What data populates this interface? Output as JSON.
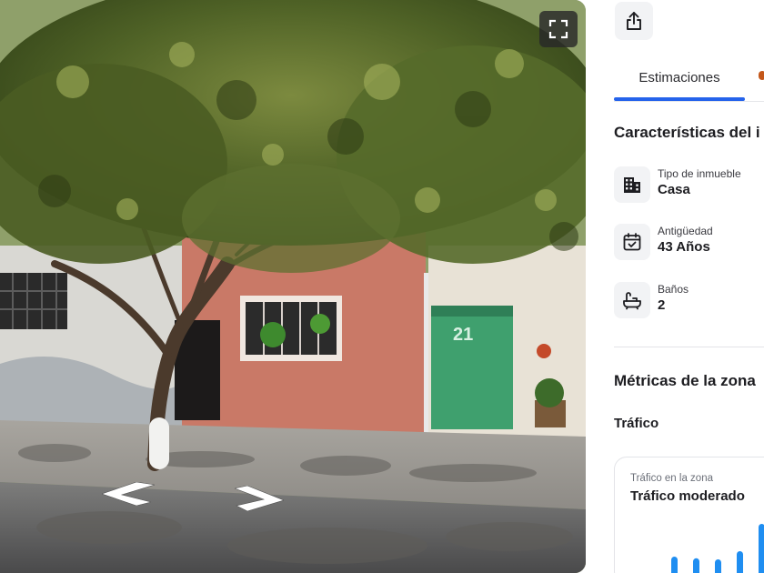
{
  "panel": {
    "tabs": [
      {
        "label": "Estimaciones"
      }
    ],
    "features_title": "Características del i",
    "features": [
      {
        "label": "Tipo de inmueble",
        "value": "Casa",
        "icon": "building-icon"
      },
      {
        "label": "Antigüedad",
        "value": "43 Años",
        "icon": "calendar-check-icon"
      },
      {
        "label": "Baños",
        "value": "2",
        "icon": "bathtub-icon"
      }
    ],
    "metrics_title": "Métricas de la zona",
    "traffic_title": "Tráfico",
    "traffic_card": {
      "label": "Tráfico en la zona",
      "value": "Tráfico moderado",
      "bars": [
        0.35,
        0.32,
        0.3,
        0.45,
        0.95
      ]
    }
  },
  "street": {
    "house_number": "21",
    "icons": [
      "fullscreen-icon",
      "arrow-left-icon",
      "arrow-right-icon"
    ]
  },
  "colors": {
    "accent": "#2563eb",
    "tab_hint": "#c4571a",
    "icon_bg": "#f2f3f5",
    "bar": "#1f8ef1"
  }
}
